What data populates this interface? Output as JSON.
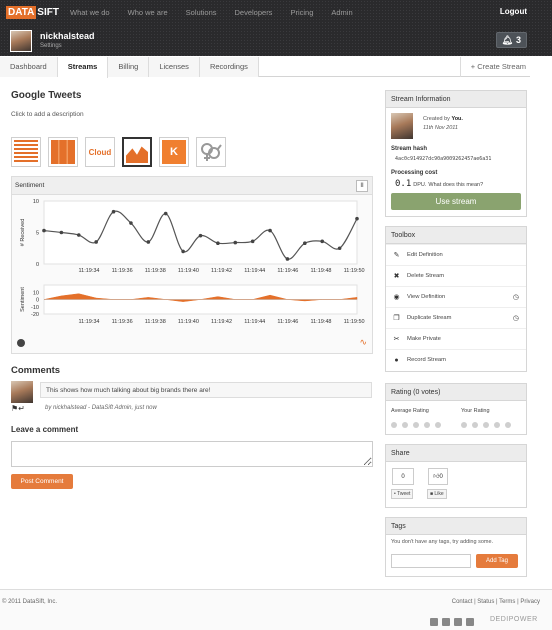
{
  "brand": {
    "logo_box": "DATA",
    "logo_rest": "SIFT",
    "accent": "#e4702a"
  },
  "topnav": {
    "items": [
      "What we do",
      "Who we are",
      "Solutions",
      "Developers",
      "Pricing",
      "Admin"
    ],
    "logout": "Logout"
  },
  "user": {
    "name": "nickhalstead",
    "settings": "Settings",
    "notifications": "3"
  },
  "tabs": {
    "items": [
      "Dashboard",
      "Streams",
      "Billing",
      "Licenses",
      "Recordings"
    ],
    "active": "Streams",
    "new_stream": "+ Create Stream"
  },
  "stream": {
    "title": "Google Tweets",
    "description_prompt": "Click to add a description"
  },
  "stream_icons": [
    "stripes-icon",
    "map-icon",
    "tag-cloud-icon",
    "sentiment-chart-icon",
    "klout-icon",
    "gender-icon"
  ],
  "stream_icon_text": {
    "cloud": "Cloud",
    "klout": "K"
  },
  "chart": {
    "header": "Sentiment",
    "pause": "II"
  },
  "chart_data": [
    {
      "type": "line",
      "ylabel": "# Received",
      "ylim": [
        0,
        10
      ],
      "yticks": [
        0,
        5,
        10
      ],
      "xticks": [
        "11:19:34",
        "11:19:36",
        "11:19:38",
        "11:19:40",
        "11:19:42",
        "11:19:44",
        "11:19:46",
        "11:19:48",
        "11:19:50"
      ],
      "x": [
        0,
        1,
        2,
        3,
        4,
        5,
        6,
        7,
        8,
        9,
        10,
        11,
        12,
        13,
        14,
        15,
        16,
        17,
        18
      ],
      "values": [
        5.3,
        5,
        4.6,
        3.5,
        8.3,
        6.5,
        3.5,
        8,
        2,
        4.5,
        3.3,
        3.4,
        3.6,
        5.3,
        0.8,
        3.3,
        3.6,
        2.5,
        7.2
      ],
      "color": "#555555"
    },
    {
      "type": "area",
      "ylabel": "Sentiment",
      "ylim": [
        -20,
        20
      ],
      "yticks": [
        10,
        0,
        -10,
        -20
      ],
      "xticks": [
        "11:19:34",
        "11:19:36",
        "11:19:38",
        "11:19:40",
        "11:19:42",
        "11:19:44",
        "11:19:46",
        "11:19:48",
        "11:19:50"
      ],
      "x": [
        0,
        1,
        2,
        3,
        4,
        5,
        6,
        7,
        8,
        9,
        10,
        11,
        12,
        13,
        14,
        15,
        16,
        17,
        18
      ],
      "values": [
        0,
        5,
        8,
        2,
        0,
        0,
        3,
        0,
        -3,
        0,
        4,
        0,
        0,
        6,
        0,
        -2,
        0,
        0,
        3
      ],
      "color": "#e4702a"
    }
  ],
  "comments": {
    "title": "Comments",
    "items": [
      {
        "text": "This shows how much talking about big brands there are!",
        "byline": "by nickhalstead - DataSift Admin, just now"
      }
    ],
    "leave_title": "Leave a comment",
    "post_button": "Post Comment"
  },
  "info": {
    "title": "Stream Information",
    "created_by_label": "Created by",
    "created_by": "You.",
    "date": "11th Nov 2011",
    "hash_label": "Stream hash",
    "hash": "4ac0c914927dc90a9009262457ae6a31",
    "cost_label": "Processing cost",
    "cost_value": "0.1",
    "cost_unit": "DPU.",
    "cost_help": "What does this mean?",
    "use_button": "Use stream",
    "use_color": "#8aa36f"
  },
  "toolbox": {
    "title": "Toolbox",
    "items": [
      {
        "label": "Edit Definition",
        "icon": "pencil-icon",
        "glyph": "✎",
        "clock": ""
      },
      {
        "label": "Delete Stream",
        "icon": "cross-icon",
        "glyph": "✖",
        "clock": ""
      },
      {
        "label": "View Definition",
        "icon": "eye-icon",
        "glyph": "◉",
        "clock": "◷"
      },
      {
        "label": "Duplicate Stream",
        "icon": "copy-icon",
        "glyph": "❐",
        "clock": "◷"
      },
      {
        "label": "Make Private",
        "icon": "private-icon",
        "glyph": "✂",
        "clock": ""
      },
      {
        "label": "Record Stream",
        "icon": "record-icon",
        "glyph": "●",
        "clock": ""
      }
    ]
  },
  "rating": {
    "title": "Rating (0 votes)",
    "average_label": "Average Rating",
    "your_label": "Your Rating"
  },
  "share": {
    "title": "Share",
    "tweet_count": "0",
    "like_count": "0",
    "tweet": "Tweet",
    "like": "Like"
  },
  "tags": {
    "title": "Tags",
    "empty": "You don't have any tags, try adding some.",
    "add_button": "Add Tag"
  },
  "footer": {
    "copyright": "© 2011 DataSift, Inc.",
    "links": "Contact | Status | Terms | Privacy",
    "host": "DEDIPOWER"
  }
}
